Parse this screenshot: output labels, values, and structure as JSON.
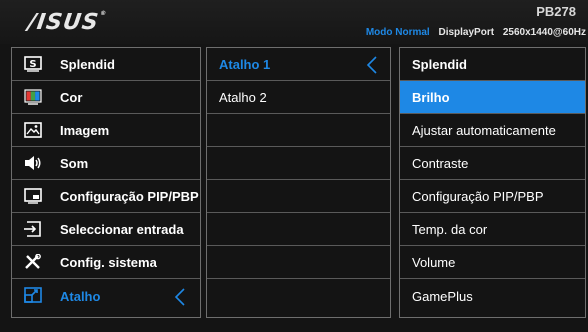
{
  "header": {
    "logo": "/ISUS",
    "model": "PB278",
    "mode": "Modo Normal",
    "port": "DisplayPort",
    "resolution": "2560x1440@60Hz"
  },
  "menu": [
    {
      "label": "Splendid",
      "icon": "splendid-s-icon"
    },
    {
      "label": "Cor",
      "icon": "color-palette-icon"
    },
    {
      "label": "Imagem",
      "icon": "image-icon"
    },
    {
      "label": "Som",
      "icon": "speaker-icon"
    },
    {
      "label": "Configuração PIP/PBP",
      "icon": "pip-pbp-icon"
    },
    {
      "label": "Seleccionar entrada",
      "icon": "input-select-icon"
    },
    {
      "label": "Config. sistema",
      "icon": "tools-icon"
    },
    {
      "label": "Atalho",
      "icon": "shortcut-icon",
      "selected": true
    }
  ],
  "submenu": [
    {
      "label": "Atalho 1",
      "selected": true
    },
    {
      "label": "Atalho 2"
    },
    {
      "label": ""
    },
    {
      "label": ""
    },
    {
      "label": ""
    },
    {
      "label": ""
    },
    {
      "label": ""
    },
    {
      "label": ""
    }
  ],
  "options": {
    "title": "Splendid",
    "items": [
      "Brilho",
      "Ajustar automaticamente",
      "Contraste",
      "Configuração PIP/PBP",
      "Temp. da cor",
      "Volume",
      "GamePlus"
    ],
    "active_index": 0
  },
  "colors": {
    "accent": "#1e88e5",
    "background": "#141414",
    "border": "#6e6e6e"
  }
}
